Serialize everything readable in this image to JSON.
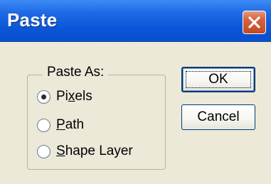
{
  "window": {
    "title": "Paste",
    "close_icon": "close-icon"
  },
  "paste_as": {
    "legend": "Paste As:",
    "options": [
      {
        "pre": "Pi",
        "mnemonic": "x",
        "post": "els",
        "checked": true
      },
      {
        "pre": "",
        "mnemonic": "P",
        "post": "ath",
        "checked": false
      },
      {
        "pre": "",
        "mnemonic": "S",
        "post": "hape Layer",
        "checked": false
      }
    ]
  },
  "buttons": {
    "ok_label": "OK",
    "cancel_label": "Cancel"
  },
  "colors": {
    "titlebar": "#0a55d8",
    "dialog_bg": "#ece9d8",
    "close_button": "#d6643f"
  }
}
